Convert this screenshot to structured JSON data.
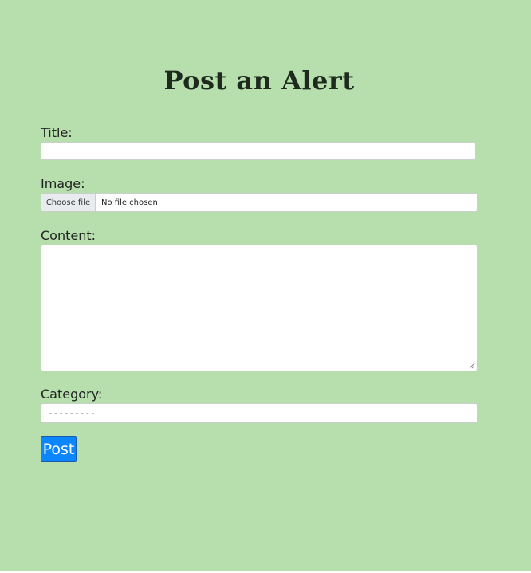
{
  "page": {
    "heading": "Post an Alert",
    "background_color": "#b6dfad"
  },
  "form": {
    "title": {
      "label": "Title:",
      "value": ""
    },
    "image": {
      "label": "Image:",
      "button_label": "Choose file",
      "status_text": "No file chosen"
    },
    "content": {
      "label": "Content:",
      "value": ""
    },
    "category": {
      "label": "Category:",
      "selected": "---------"
    },
    "submit": {
      "label": "Post",
      "color": "#0b86ff"
    }
  }
}
